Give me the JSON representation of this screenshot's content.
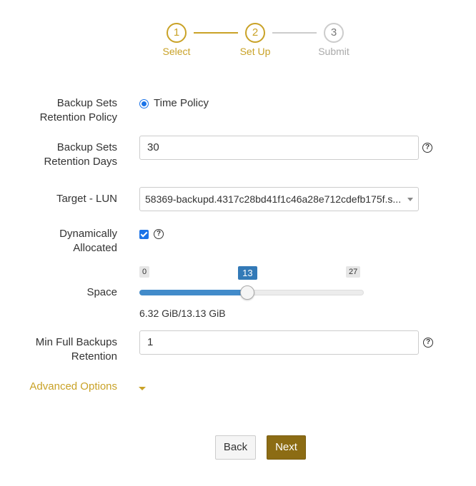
{
  "stepper": {
    "steps": [
      {
        "number": "1",
        "label": "Select",
        "state": "done"
      },
      {
        "number": "2",
        "label": "Set Up",
        "state": "active"
      },
      {
        "number": "3",
        "label": "Submit",
        "state": "inactive"
      }
    ]
  },
  "form": {
    "retention_policy": {
      "label_line1": "Backup Sets",
      "label_line2": "Retention Policy",
      "option_label": "Time Policy",
      "selected": true
    },
    "retention_days": {
      "label_line1": "Backup Sets",
      "label_line2": "Retention Days",
      "value": "30",
      "help_icon": "question-circle-icon"
    },
    "target_lun": {
      "label": "Target - LUN",
      "selected_value": "58369-backupd.4317c28bd41f1c46a28e712cdefb175f.s..."
    },
    "dynamically_allocated": {
      "label_line1": "Dynamically",
      "label_line2": "Allocated",
      "checked": true,
      "help_icon": "question-circle-icon"
    },
    "space": {
      "label": "Space",
      "min_label": "0",
      "max_label": "27",
      "value_label": "13",
      "min": 0,
      "max": 27,
      "value": 13,
      "usage_text": "6.32 GiB/13.13 GiB"
    },
    "min_full_backups": {
      "label_line1": "Min Full Backups",
      "label_line2": "Retention",
      "value": "1",
      "help_icon": "question-circle-icon"
    },
    "advanced_options": {
      "label": "Advanced Options",
      "icon": "caret-down-icon"
    }
  },
  "buttons": {
    "back_label": "Back",
    "next_label": "Next"
  },
  "colors": {
    "accent": "#c9a227",
    "primary_button": "#8c6c14",
    "slider_fill": "#428bca",
    "control_blue": "#1a73e8"
  }
}
